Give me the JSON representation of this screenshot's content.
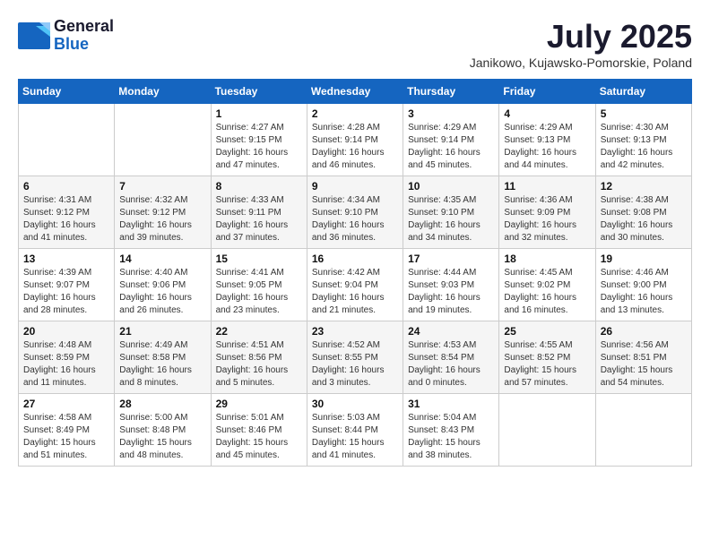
{
  "logo": {
    "line1": "General",
    "line2": "Blue"
  },
  "title": "July 2025",
  "subtitle": "Janikowo, Kujawsko-Pomorskie, Poland",
  "headers": [
    "Sunday",
    "Monday",
    "Tuesday",
    "Wednesday",
    "Thursday",
    "Friday",
    "Saturday"
  ],
  "weeks": [
    [
      {
        "num": "",
        "info": ""
      },
      {
        "num": "",
        "info": ""
      },
      {
        "num": "1",
        "info": "Sunrise: 4:27 AM\nSunset: 9:15 PM\nDaylight: 16 hours\nand 47 minutes."
      },
      {
        "num": "2",
        "info": "Sunrise: 4:28 AM\nSunset: 9:14 PM\nDaylight: 16 hours\nand 46 minutes."
      },
      {
        "num": "3",
        "info": "Sunrise: 4:29 AM\nSunset: 9:14 PM\nDaylight: 16 hours\nand 45 minutes."
      },
      {
        "num": "4",
        "info": "Sunrise: 4:29 AM\nSunset: 9:13 PM\nDaylight: 16 hours\nand 44 minutes."
      },
      {
        "num": "5",
        "info": "Sunrise: 4:30 AM\nSunset: 9:13 PM\nDaylight: 16 hours\nand 42 minutes."
      }
    ],
    [
      {
        "num": "6",
        "info": "Sunrise: 4:31 AM\nSunset: 9:12 PM\nDaylight: 16 hours\nand 41 minutes."
      },
      {
        "num": "7",
        "info": "Sunrise: 4:32 AM\nSunset: 9:12 PM\nDaylight: 16 hours\nand 39 minutes."
      },
      {
        "num": "8",
        "info": "Sunrise: 4:33 AM\nSunset: 9:11 PM\nDaylight: 16 hours\nand 37 minutes."
      },
      {
        "num": "9",
        "info": "Sunrise: 4:34 AM\nSunset: 9:10 PM\nDaylight: 16 hours\nand 36 minutes."
      },
      {
        "num": "10",
        "info": "Sunrise: 4:35 AM\nSunset: 9:10 PM\nDaylight: 16 hours\nand 34 minutes."
      },
      {
        "num": "11",
        "info": "Sunrise: 4:36 AM\nSunset: 9:09 PM\nDaylight: 16 hours\nand 32 minutes."
      },
      {
        "num": "12",
        "info": "Sunrise: 4:38 AM\nSunset: 9:08 PM\nDaylight: 16 hours\nand 30 minutes."
      }
    ],
    [
      {
        "num": "13",
        "info": "Sunrise: 4:39 AM\nSunset: 9:07 PM\nDaylight: 16 hours\nand 28 minutes."
      },
      {
        "num": "14",
        "info": "Sunrise: 4:40 AM\nSunset: 9:06 PM\nDaylight: 16 hours\nand 26 minutes."
      },
      {
        "num": "15",
        "info": "Sunrise: 4:41 AM\nSunset: 9:05 PM\nDaylight: 16 hours\nand 23 minutes."
      },
      {
        "num": "16",
        "info": "Sunrise: 4:42 AM\nSunset: 9:04 PM\nDaylight: 16 hours\nand 21 minutes."
      },
      {
        "num": "17",
        "info": "Sunrise: 4:44 AM\nSunset: 9:03 PM\nDaylight: 16 hours\nand 19 minutes."
      },
      {
        "num": "18",
        "info": "Sunrise: 4:45 AM\nSunset: 9:02 PM\nDaylight: 16 hours\nand 16 minutes."
      },
      {
        "num": "19",
        "info": "Sunrise: 4:46 AM\nSunset: 9:00 PM\nDaylight: 16 hours\nand 13 minutes."
      }
    ],
    [
      {
        "num": "20",
        "info": "Sunrise: 4:48 AM\nSunset: 8:59 PM\nDaylight: 16 hours\nand 11 minutes."
      },
      {
        "num": "21",
        "info": "Sunrise: 4:49 AM\nSunset: 8:58 PM\nDaylight: 16 hours\nand 8 minutes."
      },
      {
        "num": "22",
        "info": "Sunrise: 4:51 AM\nSunset: 8:56 PM\nDaylight: 16 hours\nand 5 minutes."
      },
      {
        "num": "23",
        "info": "Sunrise: 4:52 AM\nSunset: 8:55 PM\nDaylight: 16 hours\nand 3 minutes."
      },
      {
        "num": "24",
        "info": "Sunrise: 4:53 AM\nSunset: 8:54 PM\nDaylight: 16 hours\nand 0 minutes."
      },
      {
        "num": "25",
        "info": "Sunrise: 4:55 AM\nSunset: 8:52 PM\nDaylight: 15 hours\nand 57 minutes."
      },
      {
        "num": "26",
        "info": "Sunrise: 4:56 AM\nSunset: 8:51 PM\nDaylight: 15 hours\nand 54 minutes."
      }
    ],
    [
      {
        "num": "27",
        "info": "Sunrise: 4:58 AM\nSunset: 8:49 PM\nDaylight: 15 hours\nand 51 minutes."
      },
      {
        "num": "28",
        "info": "Sunrise: 5:00 AM\nSunset: 8:48 PM\nDaylight: 15 hours\nand 48 minutes."
      },
      {
        "num": "29",
        "info": "Sunrise: 5:01 AM\nSunset: 8:46 PM\nDaylight: 15 hours\nand 45 minutes."
      },
      {
        "num": "30",
        "info": "Sunrise: 5:03 AM\nSunset: 8:44 PM\nDaylight: 15 hours\nand 41 minutes."
      },
      {
        "num": "31",
        "info": "Sunrise: 5:04 AM\nSunset: 8:43 PM\nDaylight: 15 hours\nand 38 minutes."
      },
      {
        "num": "",
        "info": ""
      },
      {
        "num": "",
        "info": ""
      }
    ]
  ]
}
